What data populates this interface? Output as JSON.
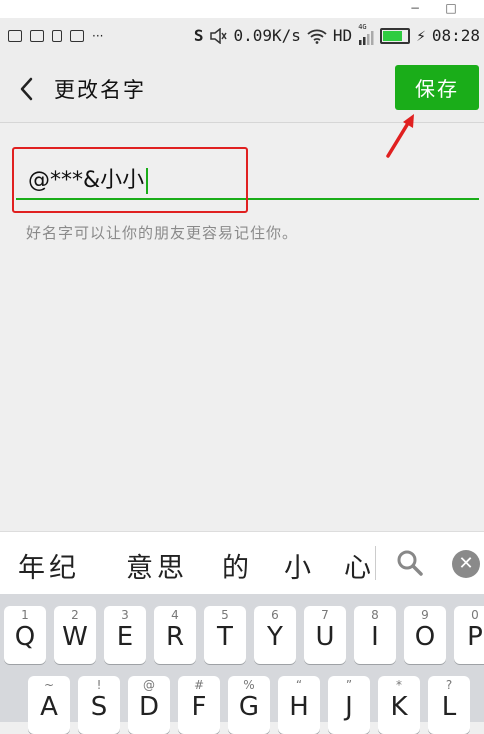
{
  "window_bar": {
    "minimize": "−",
    "maximize": "□"
  },
  "status_bar": {
    "dots": "···",
    "speed": "0.09K/s",
    "hd": "HD",
    "network": "4G",
    "time": "08:28",
    "battery_level": 0.8
  },
  "header": {
    "title": "更改名字",
    "save_label": "保存"
  },
  "name_field": {
    "value": "@***&小小"
  },
  "hint": "好名字可以让你的朋友更容易记住你。",
  "candidates": [
    "年纪",
    "意思",
    "的",
    "小",
    "心"
  ],
  "keyboard": {
    "row1": [
      {
        "sub": "1",
        "main": "Q"
      },
      {
        "sub": "2",
        "main": "W"
      },
      {
        "sub": "3",
        "main": "E"
      },
      {
        "sub": "4",
        "main": "R"
      },
      {
        "sub": "5",
        "main": "T"
      },
      {
        "sub": "6",
        "main": "Y"
      },
      {
        "sub": "7",
        "main": "U"
      },
      {
        "sub": "8",
        "main": "I"
      },
      {
        "sub": "9",
        "main": "O"
      },
      {
        "sub": "0",
        "main": "P"
      }
    ],
    "row2": [
      {
        "sub": "~",
        "main": "A"
      },
      {
        "sub": "!",
        "main": "S"
      },
      {
        "sub": "@",
        "main": "D"
      },
      {
        "sub": "#",
        "main": "F"
      },
      {
        "sub": "%",
        "main": "G"
      },
      {
        "sub": "“",
        "main": "H"
      },
      {
        "sub": "”",
        "main": "J"
      },
      {
        "sub": "*",
        "main": "K"
      },
      {
        "sub": "?",
        "main": "L"
      }
    ]
  },
  "colors": {
    "accent": "#1aad19",
    "highlight": "#e02020"
  }
}
